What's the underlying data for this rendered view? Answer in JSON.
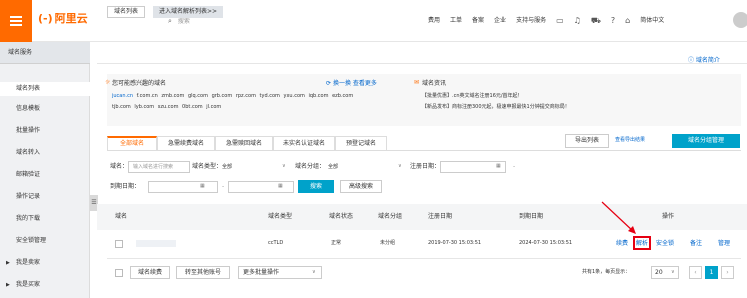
{
  "header": {
    "logo_mark": "(-)",
    "logo_text": "阿里云",
    "search_placeholder": "搜索",
    "nav": [
      "费用",
      "工单",
      "备案",
      "企业",
      "支持与服务"
    ],
    "lang": "简体中文"
  },
  "sidebar": {
    "title": "域名服务",
    "items": [
      {
        "label": "域名列表",
        "active": true
      },
      {
        "label": "信息模板"
      },
      {
        "label": "批量操作"
      },
      {
        "label": "域名转入"
      },
      {
        "label": "邮箱验证"
      },
      {
        "label": "操作记录"
      },
      {
        "label": "我的下载"
      },
      {
        "label": "安全锁管理"
      },
      {
        "label": "我是卖家",
        "expandable": true
      },
      {
        "label": "我是买家",
        "expandable": true
      }
    ]
  },
  "page_tabs": [
    "域名列表",
    "进入域名解析列表>>"
  ],
  "help_link": "域名简介",
  "interest": {
    "title": "您可能感兴趣的域名",
    "refresh": "换一换",
    "more": "查看更多",
    "row1": [
      "jucan.cn",
      "f.com.cn",
      "zmb.com",
      "glq.com",
      "grb.com",
      "rpz.com",
      "tyd.com",
      "yxu.com",
      "iqb.com",
      "ezb.com"
    ],
    "row2": [
      "tjb.com",
      "lyb.com",
      "szu.com",
      "0bt.com",
      "jl.com"
    ]
  },
  "news": {
    "title": "域名资讯",
    "line1": "【批量优惠】.cn英文域名注册16元/首年起！",
    "line2": "【新品发布】商标注册300元起，极速申报最快1分钟提交商标局！"
  },
  "domain_tabs": [
    "全部域名",
    "急需续费域名",
    "急需赎回域名",
    "未实名认证域名",
    "预登记域名"
  ],
  "toolbar": {
    "export": "导出列表",
    "export_result": "查看导出结果",
    "group_mgr": "域名分组管理"
  },
  "filters": {
    "domain_label": "域名：",
    "domain_placeholder": "输入域名进行搜索",
    "type_label": "域名类型：",
    "type_value": "全部",
    "group_label": "域名分组：",
    "group_value": "全部",
    "reg_label": "注册日期：",
    "exp_label": "到期日期：",
    "dash": "-",
    "search_btn": "搜索",
    "adv_btn": "高级搜索"
  },
  "table": {
    "headers": [
      "域名",
      "域名类型",
      "域名状态",
      "域名分组",
      "注册日期",
      "到期日期",
      "操作"
    ],
    "rows": [
      {
        "domain": "",
        "type": "ccTLD",
        "status": "正常",
        "group": "未分组",
        "reg": "2019-07-30 15:03:51",
        "exp": "2024-07-30 15:03:51",
        "actions": [
          "续费",
          "解析",
          "安全锁",
          "备注",
          "管理"
        ]
      }
    ]
  },
  "bottom": {
    "renew": "域名续费",
    "transfer": "转至其他账号",
    "more": "更多批量操作",
    "page_info": "共有1条，每页显示：",
    "page_size": "20",
    "current_page": "1"
  },
  "colors": {
    "brand": "#ff6a00",
    "primary": "#00a2ca",
    "link": "#0066cc",
    "highlight": "#e60012"
  }
}
